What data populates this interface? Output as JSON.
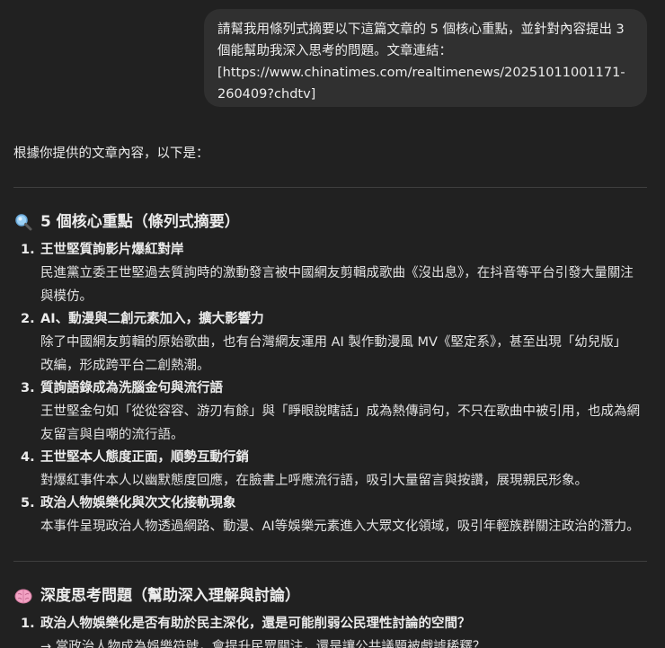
{
  "user_message": {
    "lines": [
      "請幫我用條列式摘要以下這篇文章的 5 個核心重點，並針對內容提出 3",
      "個能幫助我深入思考的問題。文章連結：",
      "[https://www.chinatimes.com/realtimenews/20251011001171-",
      "260409?chdtv]"
    ]
  },
  "assistant": {
    "intro": "根據你提供的文章內容，以下是：",
    "section1": {
      "icon": "magnifier-icon",
      "heading": "5 個核心重點（條列式摘要）",
      "items": [
        {
          "num": "1.",
          "title": "王世堅質詢影片爆紅對岸",
          "desc": [
            "民進黨立委王世堅過去質詢時的激動發言被中國網友剪輯成歌曲《沒出息》，在抖音等平台引發大量關注",
            "與模仿。"
          ]
        },
        {
          "num": "2.",
          "title": "AI、動漫與二創元素加入，擴大影響力",
          "desc": [
            "除了中國網友剪輯的原始歌曲，也有台灣網友運用 AI 製作動漫風 MV《堅定系》，甚至出現「幼兒版」",
            "改編，形成跨平台二創熱潮。"
          ]
        },
        {
          "num": "3.",
          "title": "質詢語錄成為洗腦金句與流行語",
          "desc": [
            "王世堅金句如「從從容容、游刃有餘」與「睜眼說瞎話」成為熱傳詞句，不只在歌曲中被引用，也成為網",
            "友留言與自嘲的流行語。"
          ]
        },
        {
          "num": "4.",
          "title": "王世堅本人態度正面，順勢互動行銷",
          "desc": [
            "對爆紅事件本人以幽默態度回應，在臉書上呼應流行語，吸引大量留言與按讚，展現親民形象。"
          ]
        },
        {
          "num": "5.",
          "title": "政治人物娛樂化與次文化接軌現象",
          "desc": [
            "本事件呈現政治人物透過網路、動漫、AI等娛樂元素進入大眾文化領域，吸引年輕族群關注政治的潛力。"
          ]
        }
      ]
    },
    "section2": {
      "icon": "brain-icon",
      "heading": "深度思考問題（幫助深入理解與討論）",
      "items": [
        {
          "num": "1.",
          "title": "政治人物娛樂化是否有助於民主深化，還是可能削弱公民理性討論的空間？",
          "desc": [
            "→ 當政治人物成為娛樂符號，會提升民眾關注，還是讓公共議題被戲謔稀釋？"
          ]
        }
      ]
    }
  }
}
